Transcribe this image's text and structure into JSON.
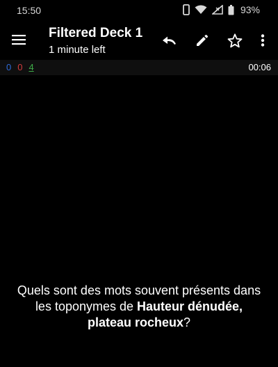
{
  "status_bar": {
    "time": "15:50",
    "battery": "93%",
    "icons": [
      "phone-vibrate-icon",
      "wifi-icon",
      "cellular-signal-icon",
      "battery-icon"
    ]
  },
  "toolbar": {
    "title": "Filtered Deck 1",
    "subtitle": "1 minute left",
    "icons": [
      "menu-icon",
      "undo-icon",
      "pencil-icon",
      "star-outline-icon",
      "more-vert-icon"
    ]
  },
  "counts": {
    "new": "0",
    "learning": "0",
    "review": "4",
    "timer": "00:06"
  },
  "card": {
    "question_line1": "Quels sont des mots souvent présents dans",
    "question_line2_prefix": "les toponymes de ",
    "question_bold1": "Hauteur dénudée,",
    "question_bold2": "plateau rocheux",
    "question_suffix": "?"
  },
  "colors": {
    "background": "#000000",
    "new_count": "#2f6bd8",
    "learning_count": "#d23c3c",
    "review_count": "#3fae49"
  }
}
